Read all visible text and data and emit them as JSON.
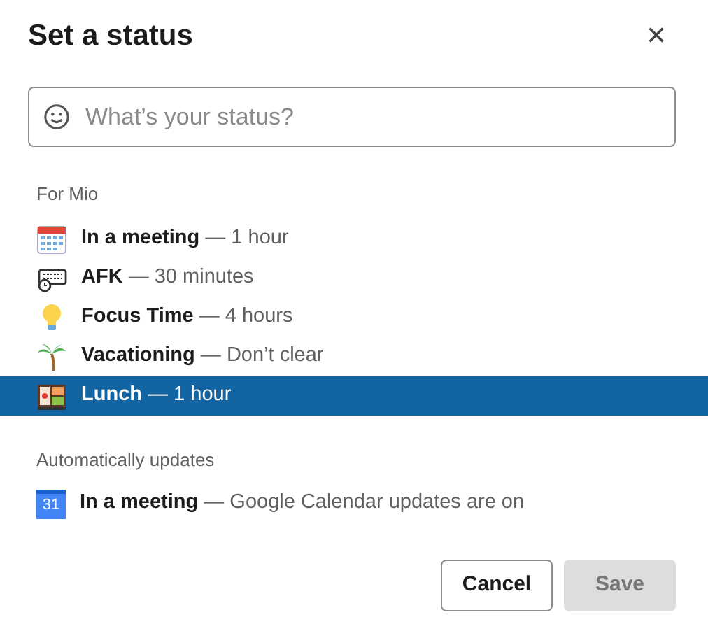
{
  "dialog": {
    "title": "Set a status",
    "close": "×"
  },
  "search": {
    "placeholder": "What’s your status?"
  },
  "sections": [
    {
      "heading": "For Mio",
      "items": [
        {
          "kind": "calendar",
          "text": "**In a meeting** — 1 hour",
          "selected": false
        },
        {
          "kind": "keyboard",
          "text": "**AFK** — 30 minutes",
          "selected": false
        },
        {
          "kind": "bulb",
          "text": "**Focus Time** — 4 hours",
          "selected": false
        },
        {
          "kind": "palm",
          "text": "**Vacationing** — Don’t clear",
          "selected": false
        },
        {
          "kind": "lunch",
          "text": "**Lunch** — 1 hour",
          "selected": true
        }
      ]
    },
    {
      "heading": "Automatically updates",
      "items": [
        {
          "kind": "gcal",
          "icon_text": "31",
          "text": "**In a meeting** — Google Calendar updates are on",
          "selected": false
        }
      ]
    }
  ],
  "buttons": [
    {
      "label": "Cancel",
      "kind": "secondary",
      "disabled": false
    },
    {
      "label": "Save",
      "kind": "primary",
      "disabled": true
    }
  ]
}
